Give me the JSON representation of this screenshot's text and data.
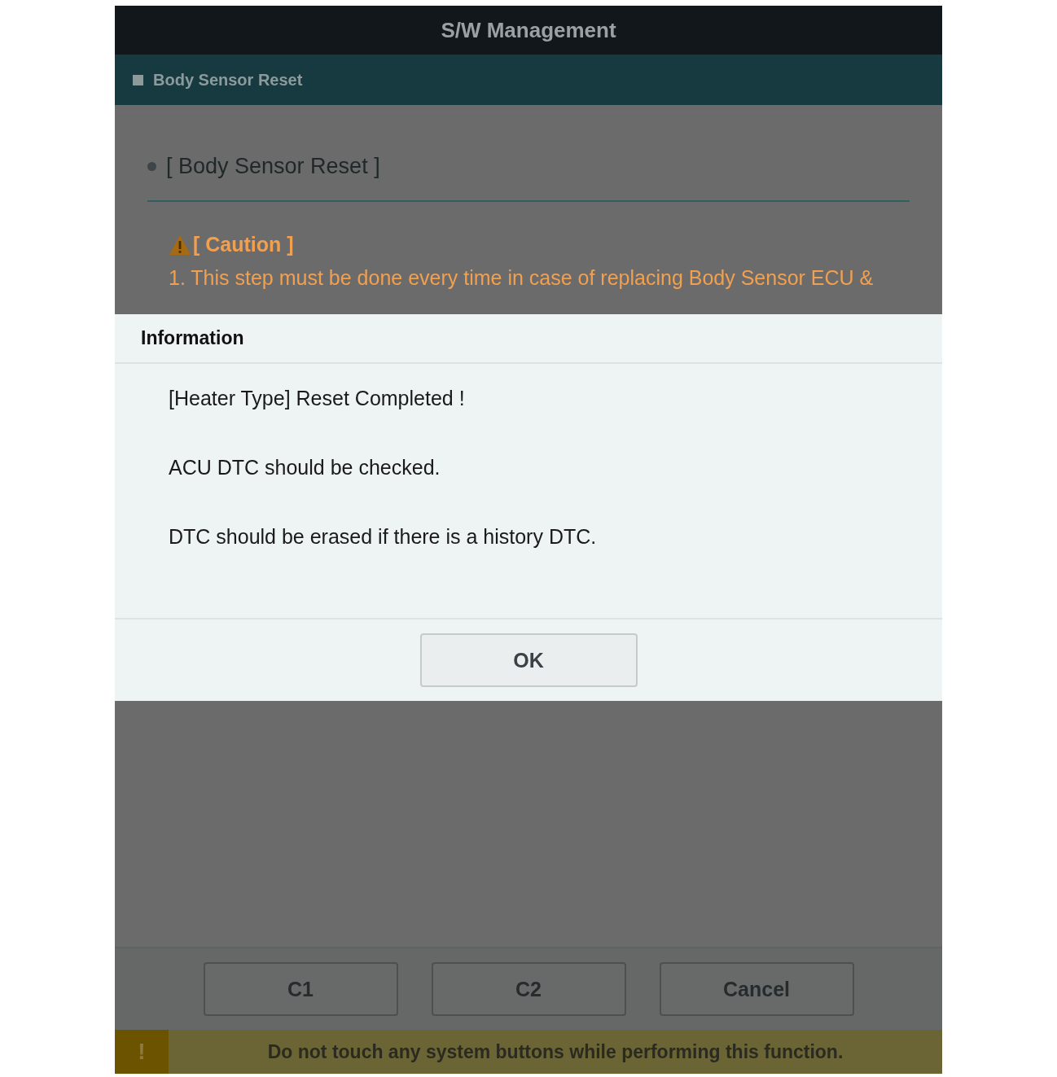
{
  "window": {
    "title": "S/W Management"
  },
  "breadcrumb": "Body Sensor Reset",
  "section": {
    "title": "[ Body Sensor Reset ]"
  },
  "caution": {
    "title": "[ Caution ]",
    "lines": [
      "1. This step must be done every time in case of replacing Body Sensor ECU &"
    ]
  },
  "dialog": {
    "title": "Information",
    "messages": [
      "[Heater Type] Reset Completed !",
      "ACU DTC should be checked.",
      "DTC should be erased if there is a history DTC."
    ],
    "buttons": [
      "OK"
    ]
  },
  "buttons": [
    {
      "label": "C1"
    },
    {
      "label": "C2"
    },
    {
      "label": "Cancel"
    }
  ],
  "status_bar": {
    "icon": "!",
    "message": "Do not touch any system buttons while performing this function."
  }
}
